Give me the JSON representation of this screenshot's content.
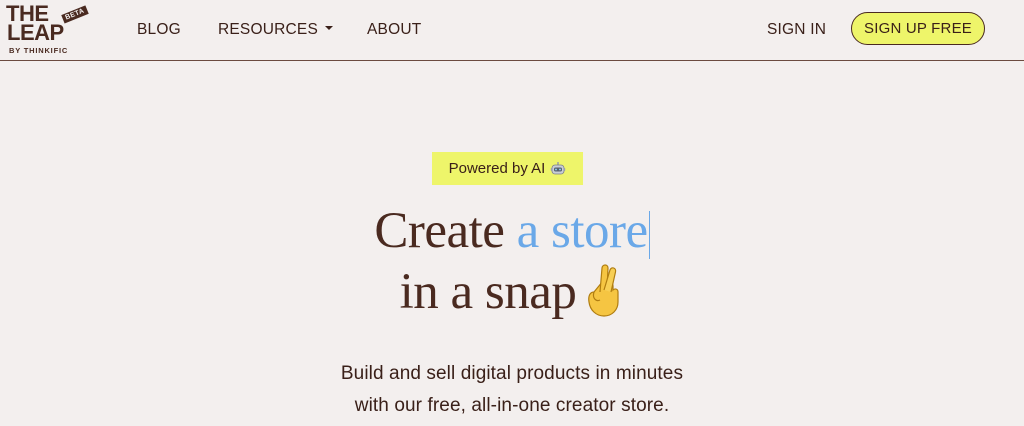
{
  "brand": {
    "logo_line1": "THE",
    "logo_line2": "LEAP",
    "beta": "BETA",
    "sub": "BY THINKIFIC"
  },
  "nav": {
    "blog": "BLOG",
    "resources": "RESOURCES",
    "about": "ABOUT",
    "sign_in": "SIGN IN",
    "sign_up": "SIGN UP FREE"
  },
  "hero": {
    "badge": "Powered by AI",
    "badge_icon": "robot-icon",
    "line1_plain": "Create ",
    "line1_accent": "a store",
    "line2": "in a snap",
    "line2_icon": "crossed-fingers-icon",
    "subtitle_line1": "Build and sell digital products in minutes",
    "subtitle_line2": "with our free, all-in-one creator store."
  },
  "colors": {
    "background": "#f3efee",
    "text": "#4a2a20",
    "accent_yellow": "#eef56a",
    "accent_blue": "#6aa8e8"
  }
}
